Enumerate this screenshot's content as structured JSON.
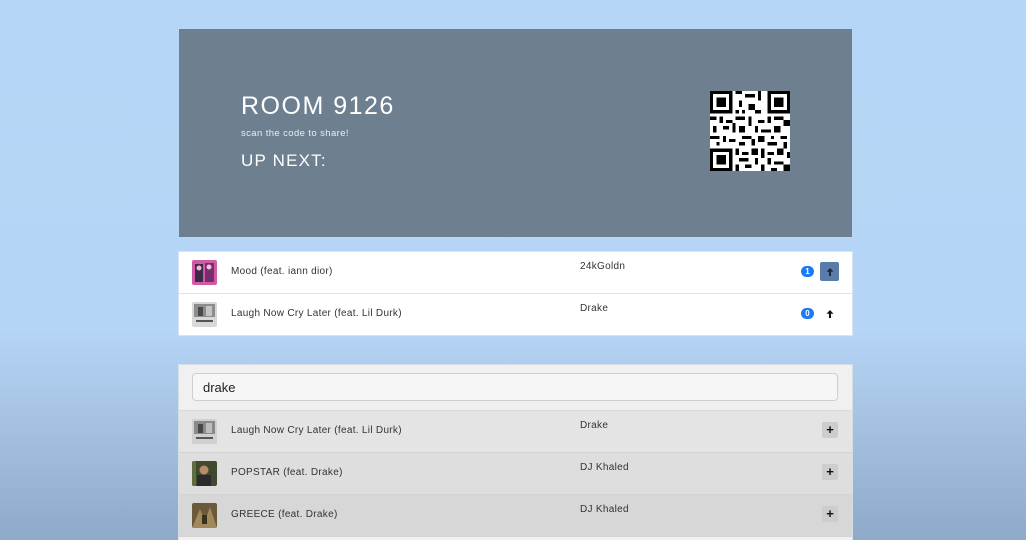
{
  "header": {
    "room_title": "ROOM 9126",
    "share_text": "scan the code to share!",
    "up_next": "UP NEXT:"
  },
  "queue": [
    {
      "title": "Mood (feat. iann dior)",
      "artist": "24kGoldn",
      "votes": "1",
      "upvoted": true,
      "art": "pink-album-art"
    },
    {
      "title": "Laugh Now Cry Later (feat. Lil Durk)",
      "artist": "Drake",
      "votes": "0",
      "upvoted": false,
      "art": "gray-album-art"
    }
  ],
  "search": {
    "value": "drake",
    "placeholder": ""
  },
  "results": [
    {
      "title": "Laugh Now Cry Later (feat. Lil Durk)",
      "artist": "Drake",
      "add": "+"
    },
    {
      "title": "POPSTAR (feat. Drake)",
      "artist": "DJ Khaled",
      "add": "+"
    },
    {
      "title": "GREECE (feat. Drake)",
      "artist": "DJ Khaled",
      "add": "+"
    }
  ],
  "colors": {
    "background": "#b6d6f7",
    "header": "#6e7f90",
    "badge": "#1d7af2",
    "upvote_active": "#5a7cab"
  },
  "icons": {
    "qr": "qr-code-icon",
    "upvote": "arrow-up-icon",
    "add": "plus-icon"
  }
}
